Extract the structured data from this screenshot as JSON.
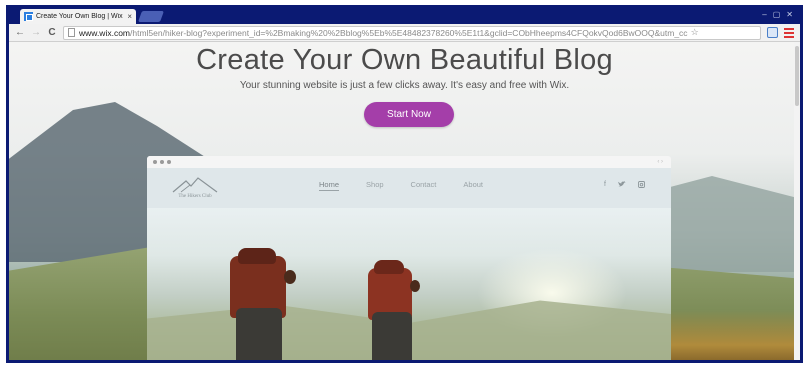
{
  "browser": {
    "tab_title": "Create Your Own Blog | Wix",
    "tab_close": "×",
    "window_controls": [
      "–",
      "▢",
      "✕"
    ],
    "url_host": "www.wix.com",
    "url_path": "/html5en/hiker-blog?experiment_id=%2Bmaking%20%2Bblog%5Eb%5E48482378260%5E1t1&gclid=CObHheepms4CFQokvQod6BwOOQ&utm_cc",
    "back": "←",
    "forward": "→",
    "reload": "C",
    "bookmark_star": "☆"
  },
  "hero": {
    "title": "Create Your Own Beautiful Blog",
    "subtitle": "Your stunning website is just a few clicks away. It's easy and free with Wix.",
    "cta": "Start Now",
    "cta_color": "#a43ea9"
  },
  "mock_site": {
    "logo_text": "The Hikers Club",
    "menu": [
      "Home",
      "Shop",
      "Contact",
      "About"
    ],
    "social": [
      "f",
      "☉",
      "▣"
    ]
  }
}
